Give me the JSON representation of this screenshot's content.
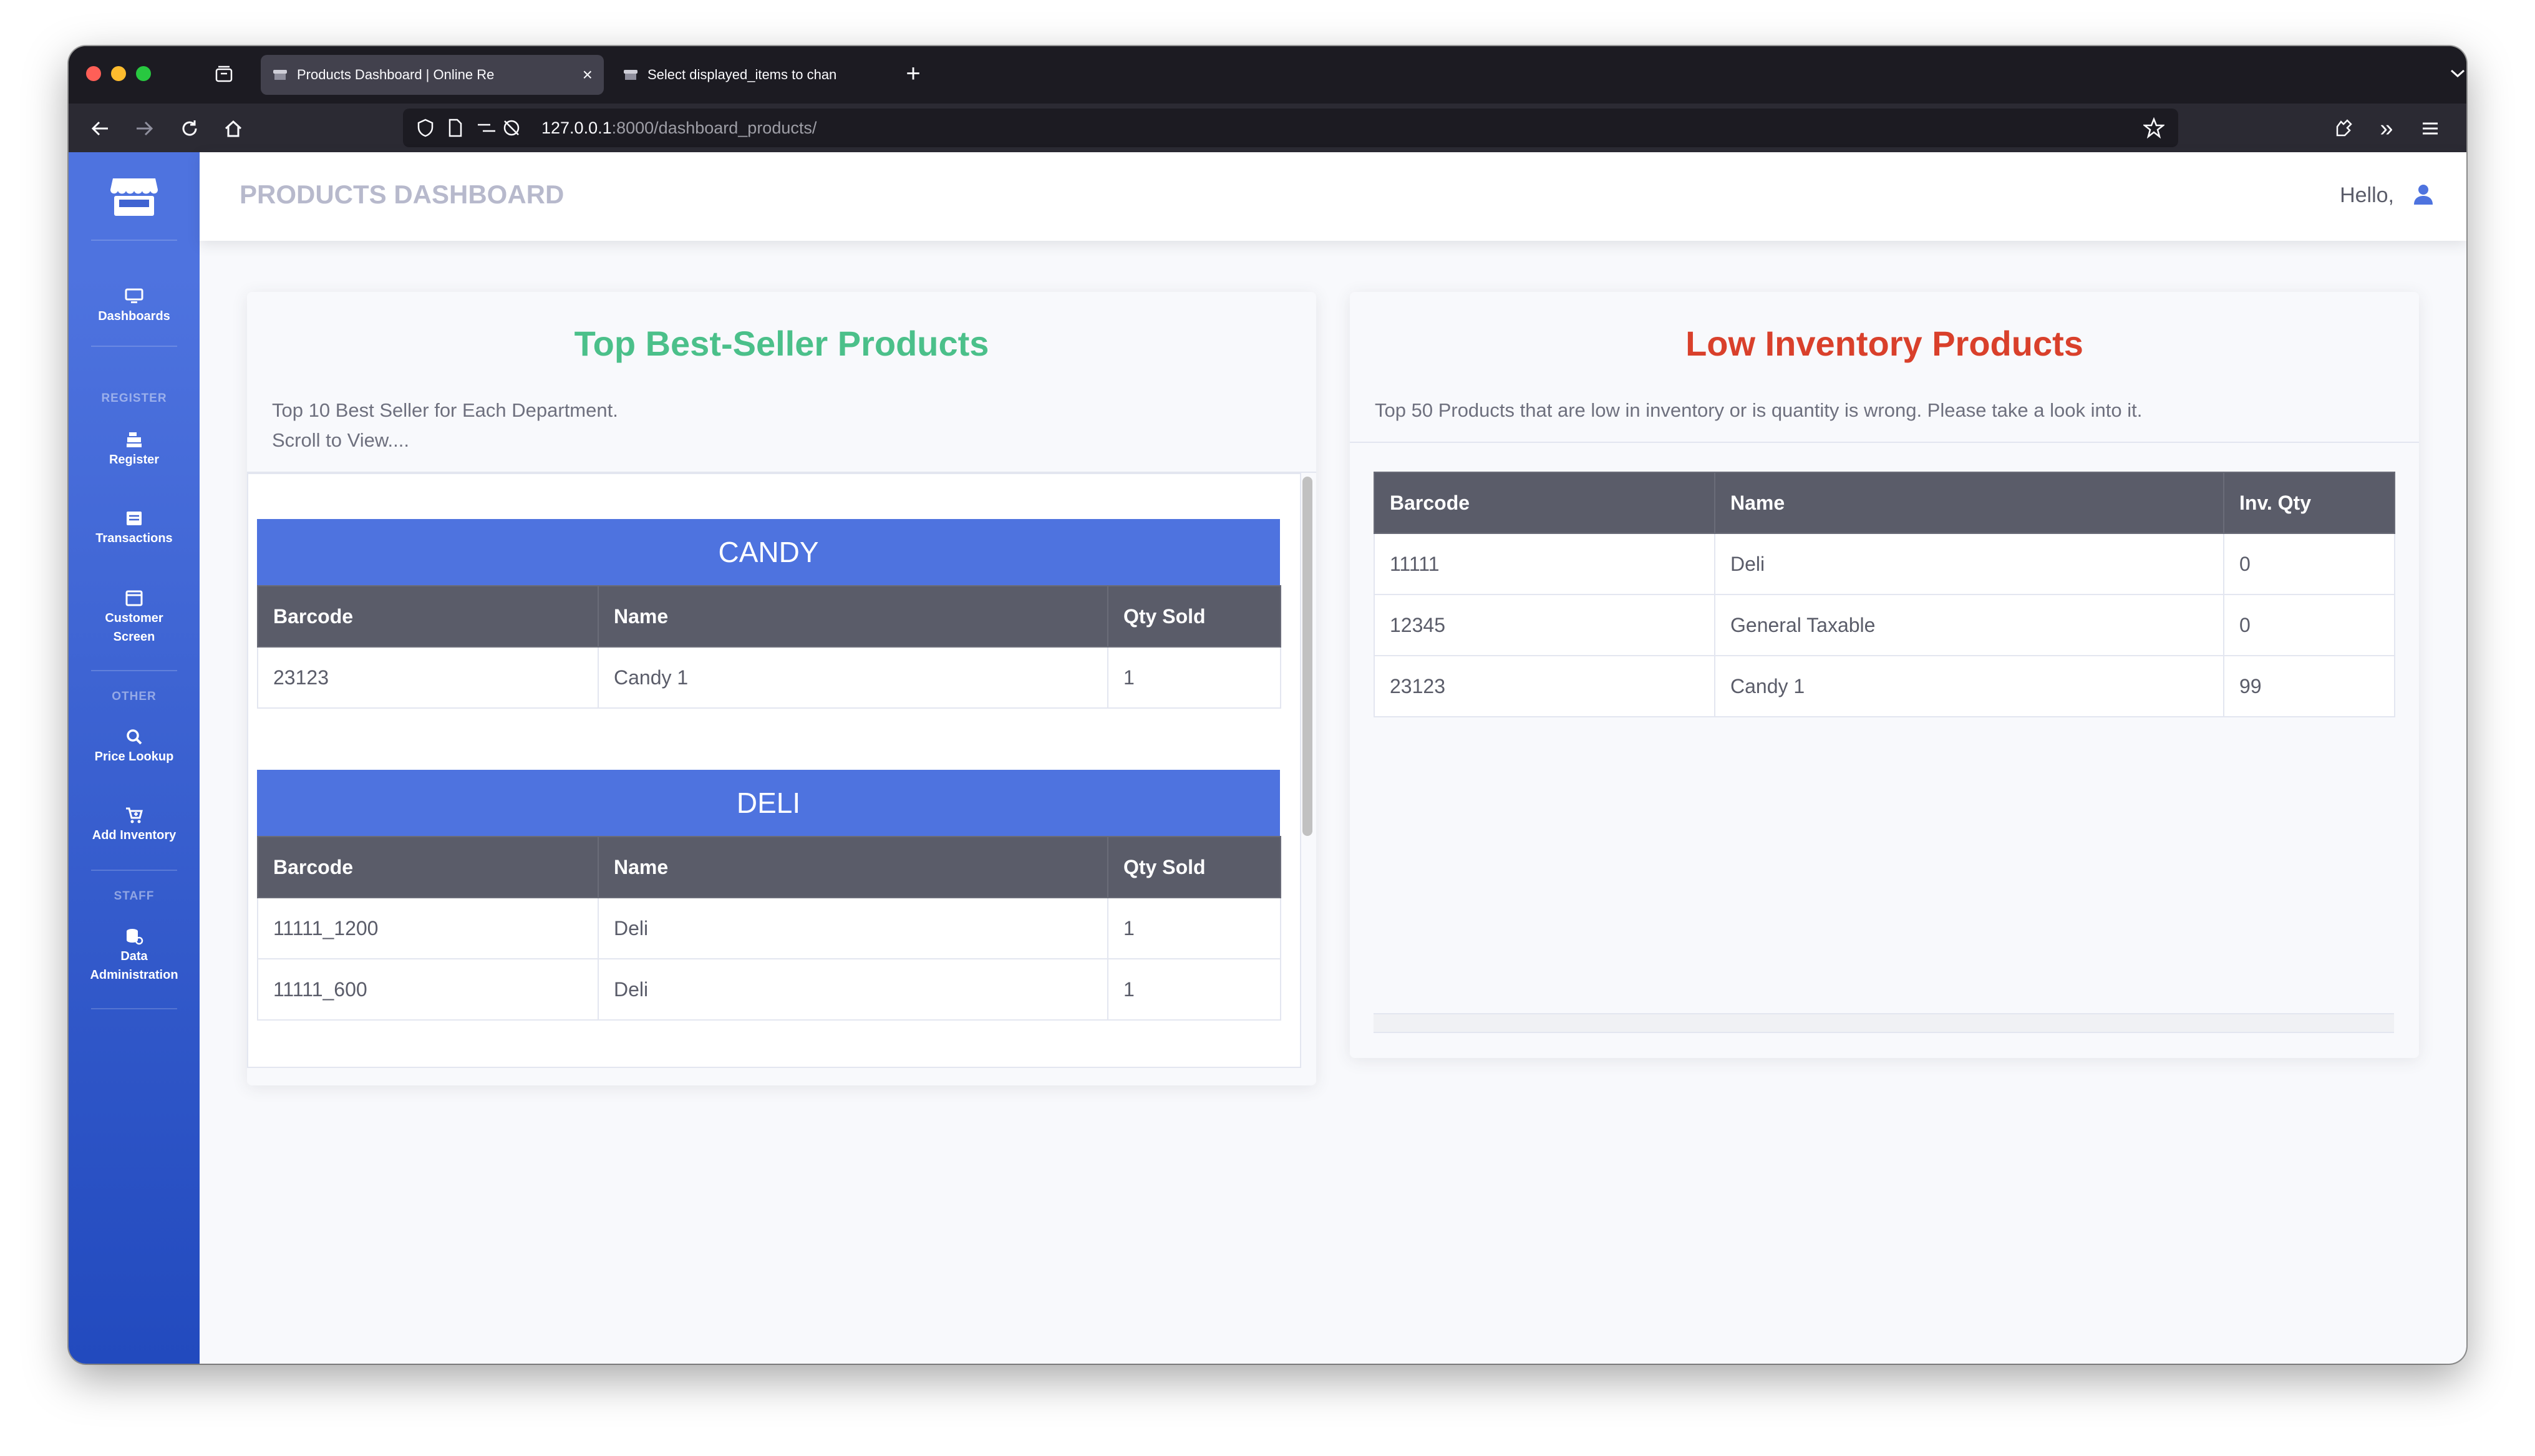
{
  "browser": {
    "tabs": [
      {
        "title": "Products Dashboard | Online Re",
        "active": true
      },
      {
        "title": "Select displayed_items to chan",
        "active": false
      }
    ],
    "url_host": "127.0.0.1",
    "url_path": ":8000/dashboard_products/"
  },
  "sidebar": {
    "headings": {
      "register": "REGISTER",
      "other": "OTHER",
      "staff": "STAFF"
    },
    "items": [
      {
        "label": "Dashboards",
        "icon": "monitor-icon"
      },
      {
        "label": "Register",
        "icon": "cash-register-icon"
      },
      {
        "label": "Transactions",
        "icon": "list-icon"
      },
      {
        "label_line1": "Customer",
        "label_line2": "Screen",
        "icon": "window-icon"
      },
      {
        "label": "Price Lookup",
        "icon": "search-icon"
      },
      {
        "label": "Add Inventory",
        "icon": "cart-plus-icon"
      },
      {
        "label_line1": "Data",
        "label_line2": "Administration",
        "icon": "database-icon"
      }
    ]
  },
  "topbar": {
    "title": "PRODUCTS DASHBOARD",
    "greeting": "Hello,"
  },
  "best_sellers": {
    "title": "Top Best-Seller Products",
    "desc_line1": "Top 10 Best Seller for Each Department.",
    "desc_line2": "Scroll to View....",
    "columns": [
      "Barcode",
      "Name",
      "Qty Sold"
    ],
    "departments": [
      {
        "name": "CANDY",
        "rows": [
          [
            "23123",
            "Candy 1",
            "1"
          ]
        ]
      },
      {
        "name": "DELI",
        "rows": [
          [
            "11111_1200",
            "Deli",
            "1"
          ],
          [
            "11111_600",
            "Deli",
            "1"
          ]
        ]
      }
    ]
  },
  "low_inventory": {
    "title": "Low Inventory Products",
    "desc": "Top 50 Products that are low in inventory or is quantity is wrong. Please take a look into it.",
    "columns": [
      "Barcode",
      "Name",
      "Inv. Qty"
    ],
    "rows": [
      [
        "11111",
        "Deli",
        "0"
      ],
      [
        "12345",
        "General Taxable",
        "0"
      ],
      [
        "23123",
        "Candy 1",
        "99"
      ]
    ]
  },
  "colors": {
    "accent": "#4e73df",
    "success": "#4bc08a",
    "danger": "#d9402b",
    "table_header": "#5a5c69"
  }
}
